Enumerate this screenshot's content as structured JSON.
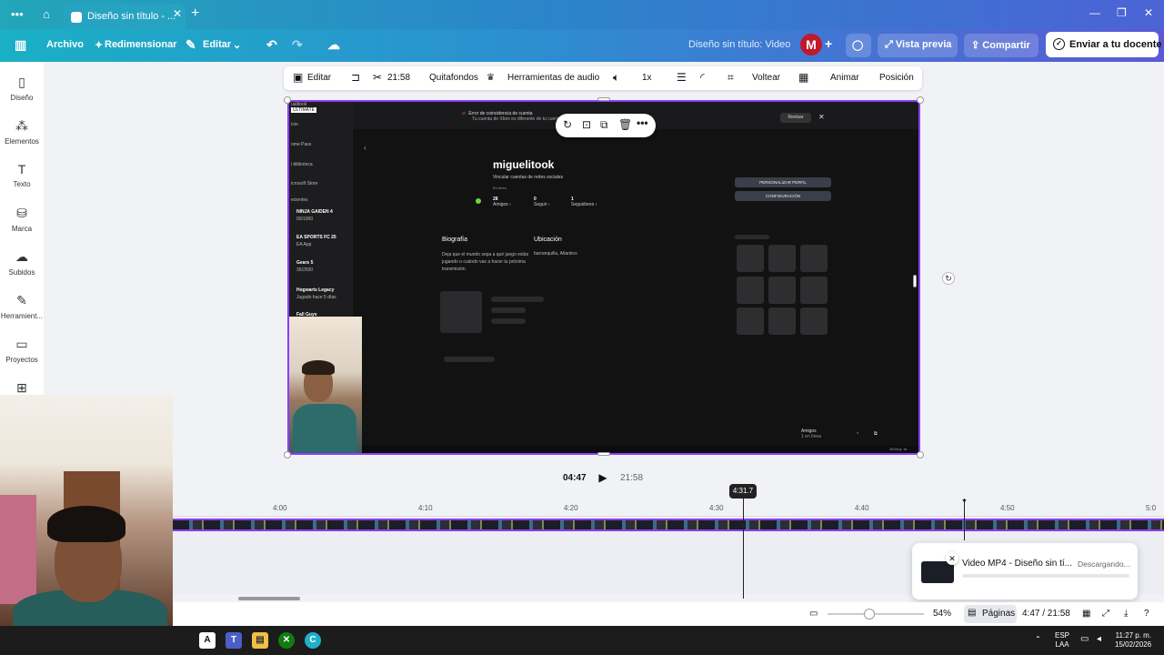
{
  "browser": {
    "tab_title": "Diseño sin título - ...",
    "close_glyph": "✕",
    "new_tab_glyph": "+"
  },
  "topbar": {
    "archivo": "Archivo",
    "redimensionar": "Redimensionar",
    "editar": "Editar",
    "doc_title": "Diseño sin título: Video",
    "avatar_letter": "M",
    "vista_previa": "Vista previa",
    "compartir": "Compartir",
    "enviar": "Enviar a tu docente"
  },
  "sidebar": {
    "items": [
      {
        "label": "Diseño",
        "icon": "▯"
      },
      {
        "label": "Elementos",
        "icon": "⁂"
      },
      {
        "label": "Texto",
        "icon": "T"
      },
      {
        "label": "Marca",
        "icon": "⛁"
      },
      {
        "label": "Subidos",
        "icon": "☁"
      },
      {
        "label": "Herramient...",
        "icon": "✎"
      },
      {
        "label": "Proyectos",
        "icon": "▭"
      }
    ]
  },
  "editor_toolbar": {
    "editar": "Editar",
    "duration": "21:58",
    "quitafondos": "Quitafondos",
    "herramientas_audio": "Herramientas de audio",
    "speed": "1x",
    "voltear": "Voltear",
    "animar": "Animar",
    "posicion": "Posición"
  },
  "video_frame": {
    "sidebar": {
      "brand_line1": "ualitook",
      "brand_line2": "ULTIMATE",
      "items": [
        "ício",
        "ome Pass",
        "i biblioteca",
        "icrosoft Store",
        "ecientes"
      ],
      "games": [
        {
          "name": "NINJA GAIDEN 4",
          "sub": "00/1000"
        },
        {
          "name": "EA SPORTS FC 25",
          "sub": "EA App"
        },
        {
          "name": "Gears 5",
          "sub": "35/2500"
        },
        {
          "name": "Hogwarts Legacy",
          "sub": "Jugado hace 5 días"
        },
        {
          "name": "Fall Guys",
          "sub": ""
        }
      ]
    },
    "error_title": "Error de coincidencia de cuenta",
    "error_sub": "Tu cuenta de Xbox es diferente de tu cuenta de...",
    "revisar": "Revisar",
    "gamertag": "miguelitook",
    "vincular": "Vincular cuentas de redes sociales",
    "en_linea": "En línea",
    "stats": [
      {
        "value": "28",
        "label": "Amigos"
      },
      {
        "value": "0",
        "label": "Seguir"
      },
      {
        "value": "1",
        "label": "Seguidores"
      }
    ],
    "btn_personalizar": "PERSONALIZAR PERFIL",
    "btn_configuracion": "CONFIGURACIÓN",
    "biografia_h": "Biografía",
    "biografia_t": "Deja que el mundo sepa a qué juego estás jugando o cuándo vas a hacer tu próxima transmisión.",
    "ubicacion_h": "Ubicación",
    "ubicacion_t": "barranquilla, Atlantico",
    "amigos_title": "Amigos",
    "amigos_sub": "1 en línea",
    "clock": "10:04 p. m."
  },
  "playback": {
    "current": "04:47",
    "total": "21:58"
  },
  "timeline": {
    "ticks": [
      "4:00",
      "4:10",
      "4:20",
      "4:30",
      "4:40",
      "4:50",
      "5:0"
    ],
    "playhead_label": "4:31.7"
  },
  "toast": {
    "title": "Video MP4 - Diseño sin tí...",
    "status": "Descargando..."
  },
  "statusbar": {
    "zoom": "54%",
    "pages": "Páginas",
    "time_position": "4:47 / 21:58"
  },
  "win_taskbar": {
    "lang_top": "ESP",
    "lang_bottom": "LAA",
    "time": "11:27 p. m.",
    "date": "15/02/2026"
  }
}
